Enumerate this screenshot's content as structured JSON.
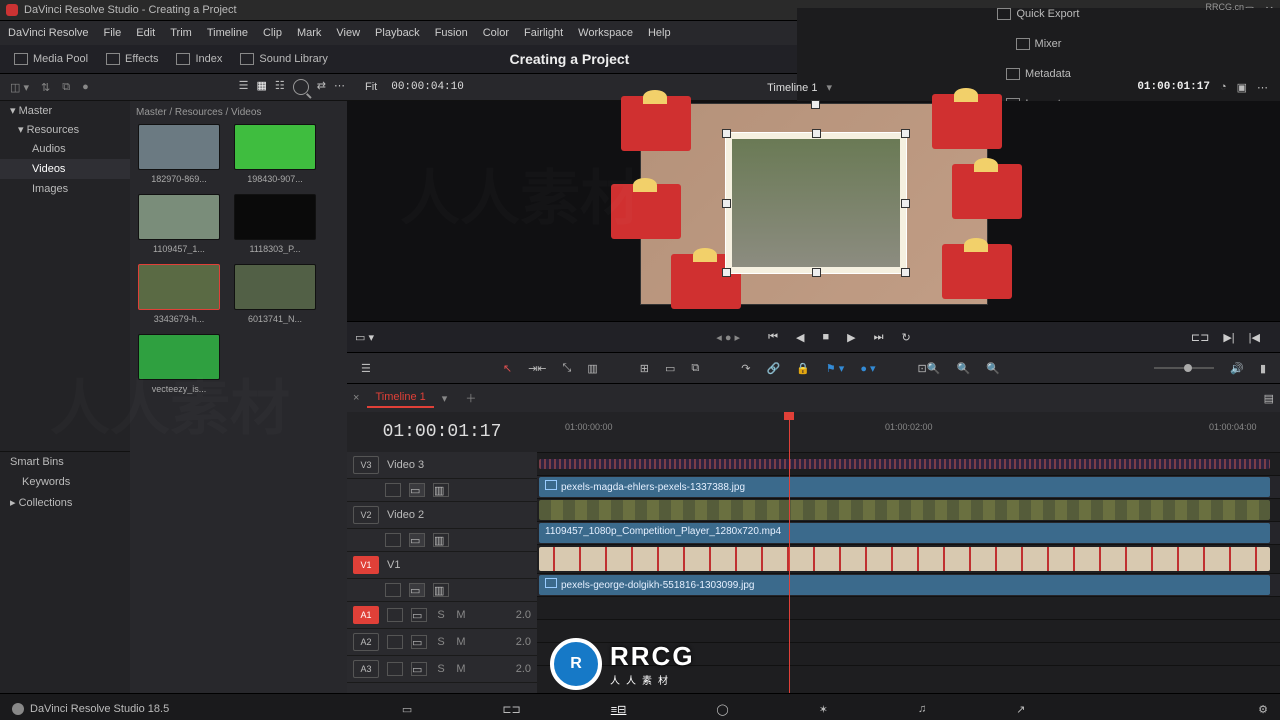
{
  "titlebar": {
    "title": "DaVinci Resolve Studio - Creating a Project"
  },
  "menubar": [
    "DaVinci Resolve",
    "File",
    "Edit",
    "Trim",
    "Timeline",
    "Clip",
    "Mark",
    "View",
    "Playback",
    "Fusion",
    "Color",
    "Fairlight",
    "Workspace",
    "Help"
  ],
  "toolbar": {
    "left": [
      {
        "name": "media-pool",
        "label": "Media Pool"
      },
      {
        "name": "effects",
        "label": "Effects"
      },
      {
        "name": "index",
        "label": "Index"
      },
      {
        "name": "sound-library",
        "label": "Sound Library"
      }
    ],
    "center": "Creating a Project",
    "right": [
      {
        "name": "quick-export",
        "label": "Quick Export"
      },
      {
        "name": "mixer",
        "label": "Mixer"
      },
      {
        "name": "metadata",
        "label": "Metadata"
      },
      {
        "name": "inspector",
        "label": "Inspector"
      }
    ]
  },
  "toolbar2_left": {
    "fit": "Fit",
    "tc": "00:00:04:10"
  },
  "toolbar2_center": "Timeline 1",
  "toolbar2_right_tc": "01:00:01:17",
  "sidebar": {
    "master": "Master",
    "resources": "Resources",
    "items": [
      "Audios",
      "Videos",
      "Images"
    ],
    "selected": 1,
    "smartbins": "Smart Bins",
    "smartitems": [
      "Keywords",
      "Collections"
    ]
  },
  "media": {
    "breadcrumb": "Master / Resources / Videos",
    "thumbs": [
      {
        "cap": "182970-869...",
        "bg": "#6b7a82"
      },
      {
        "cap": "198430-907...",
        "bg": "#3fbd3f"
      },
      {
        "cap": "1109457_1...",
        "bg": "#7a8d7a"
      },
      {
        "cap": "1118303_P...",
        "bg": "#0a0a0a"
      },
      {
        "cap": "3343679-h...",
        "bg": "#5a6a44",
        "sel": true
      },
      {
        "cap": "6013741_N...",
        "bg": "#526046"
      },
      {
        "cap": "vecteezy_is...",
        "bg": "#2fa040"
      }
    ]
  },
  "transport": {
    "buttons": [
      "prev",
      "back",
      "stop",
      "play",
      "next",
      "loop"
    ]
  },
  "tabs": {
    "active": "Timeline 1"
  },
  "timeline": {
    "tc": "01:00:01:17",
    "ruler": [
      "01:00:00:00",
      "01:00:02:00",
      "01:00:04:00"
    ],
    "tracks": [
      {
        "id": "V3",
        "name": "Video 3",
        "clip": "pexels-magda-ehlers-pexels-1337388.jpg"
      },
      {
        "id": "V2",
        "name": "Video 2",
        "clip": "1109457_1080p_Competition_Player_1280x720.mp4"
      },
      {
        "id": "V1",
        "name": "V1",
        "clip": "pexels-george-dolgikh-551816-1303099.jpg",
        "on": true
      }
    ],
    "audio": [
      {
        "id": "A1",
        "vol": "2.0",
        "on": true
      },
      {
        "id": "A2",
        "vol": "2.0"
      },
      {
        "id": "A3",
        "vol": "2.0"
      }
    ]
  },
  "footer": {
    "version": "DaVinci Resolve Studio 18.5"
  },
  "watermark": {
    "site": "RRCG.cn",
    "brand": "RRCG",
    "sub": "人人素材"
  }
}
